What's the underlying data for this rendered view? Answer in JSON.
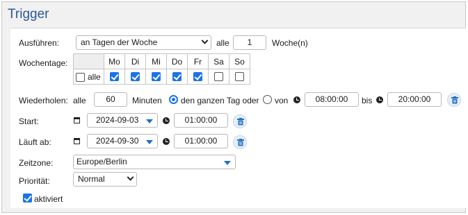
{
  "title": "Trigger",
  "run": {
    "label": "Ausführen:",
    "mode": "an Tagen der Woche",
    "every_label": "alle",
    "every_value": "1",
    "unit": "Woche(n)"
  },
  "weekdays": {
    "label": "Wochentage:",
    "all_label": "alle",
    "all_checked": false,
    "days": [
      {
        "name": "Mo",
        "checked": true
      },
      {
        "name": "Di",
        "checked": true
      },
      {
        "name": "Mi",
        "checked": true
      },
      {
        "name": "Do",
        "checked": true
      },
      {
        "name": "Fr",
        "checked": true
      },
      {
        "name": "Sa",
        "checked": false
      },
      {
        "name": "So",
        "checked": false
      }
    ]
  },
  "repeat": {
    "label": "Wiederholen:",
    "every_label": "alle",
    "value": "60",
    "minutes_label": "Minuten",
    "all_day_label": "den ganzen Tag oder",
    "from_label": "von",
    "from_time": "08:00:00",
    "to_label": "bis",
    "to_time": "20:00:00"
  },
  "start": {
    "label": "Start:",
    "date": "2024-09-03",
    "time": "01:00:00"
  },
  "expires": {
    "label": "Läuft ab:",
    "date": "2024-09-30",
    "time": "01:00:00"
  },
  "timezone": {
    "label": "Zeitzone:",
    "value": "Europe/Berlin"
  },
  "priority": {
    "label": "Priorität:",
    "value": "Normal"
  },
  "enabled": {
    "label": "aktiviert",
    "checked": true
  },
  "colors": {
    "title": "#2a579a",
    "accent": "#1a73e8",
    "dropdown_arrow": "#1f6fc5",
    "trash_icon": "#1f6fc5"
  }
}
